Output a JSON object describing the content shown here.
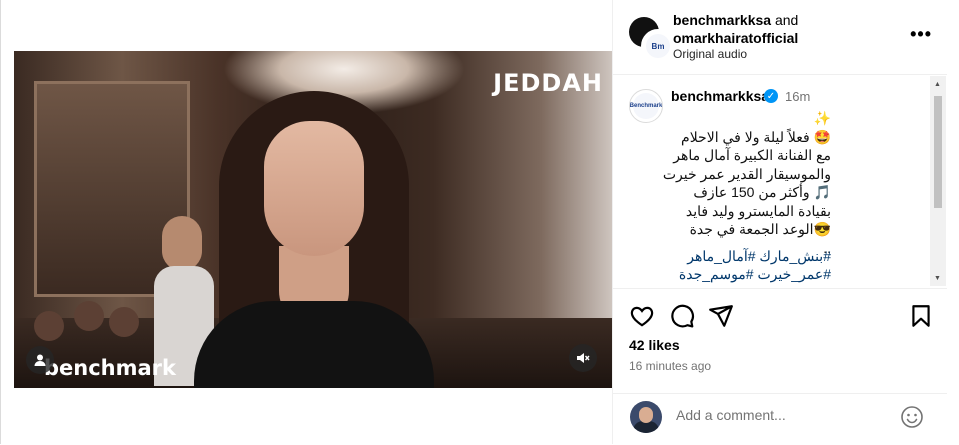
{
  "post": {
    "media": {
      "watermark": "JEDDAH",
      "brand_overlay": "benchmark",
      "mute_icon": "speaker-muted-icon",
      "tagged_users_icon": "person-icon"
    },
    "header": {
      "user_primary": "benchmarkksa",
      "joiner": " and ",
      "user_secondary": "omarkhairatofficial",
      "audio": "Original audio",
      "more_icon": "more-horizontal-icon",
      "more_label": "•••"
    },
    "caption": {
      "avatar_text": "Benchmark",
      "username": "benchmarkksa",
      "verified_icon": "verified-badge-icon",
      "verified_glyph": "✓",
      "time": "16m",
      "text": "✨\n🤩 فعلاً ليلة ولا في الاحلام\nمع الفنانة الكبيرة آمال ماهر\nوالموسيقار القدير عمر خيرت\n🎵 وأكثر من 150 عازف\nبقيادة المايسترو وليد فايد\n😎الوعد الجمعة في جدة\n..",
      "hashtags_line1": "#بنش_مارك #آمال_ماهر",
      "hashtags_line2": "#عمر_خيرت #موسم_جدة"
    },
    "actions": {
      "like_icon": "heart-icon",
      "comment_icon": "comment-icon",
      "share_icon": "share-icon",
      "save_icon": "bookmark-icon",
      "likes": "42 likes",
      "time_ago": "16 minutes ago"
    },
    "comment": {
      "placeholder": "Add a comment...",
      "emoji_icon": "emoji-icon"
    }
  }
}
